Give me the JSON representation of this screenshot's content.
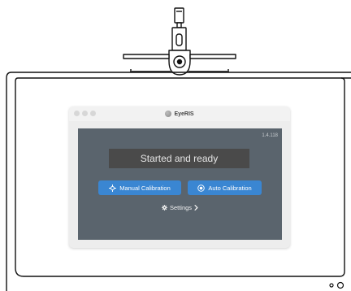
{
  "window": {
    "title": "EyeRIS",
    "version": "1.4.118"
  },
  "status": {
    "text": "Started and ready"
  },
  "buttons": {
    "manual_calibration": "Manual Calibration",
    "auto_calibration": "Auto Calibration"
  },
  "settings": {
    "label": "Settings"
  },
  "icons": {
    "manual": "crosshair-icon",
    "auto": "target-icon",
    "settings": "gear-icon",
    "chevron": "chevron-right-icon",
    "logo": "eyeris-logo-icon"
  },
  "colors": {
    "panel": "#5a646d",
    "status_box": "#4a4a4a",
    "button": "#3a86d2"
  }
}
